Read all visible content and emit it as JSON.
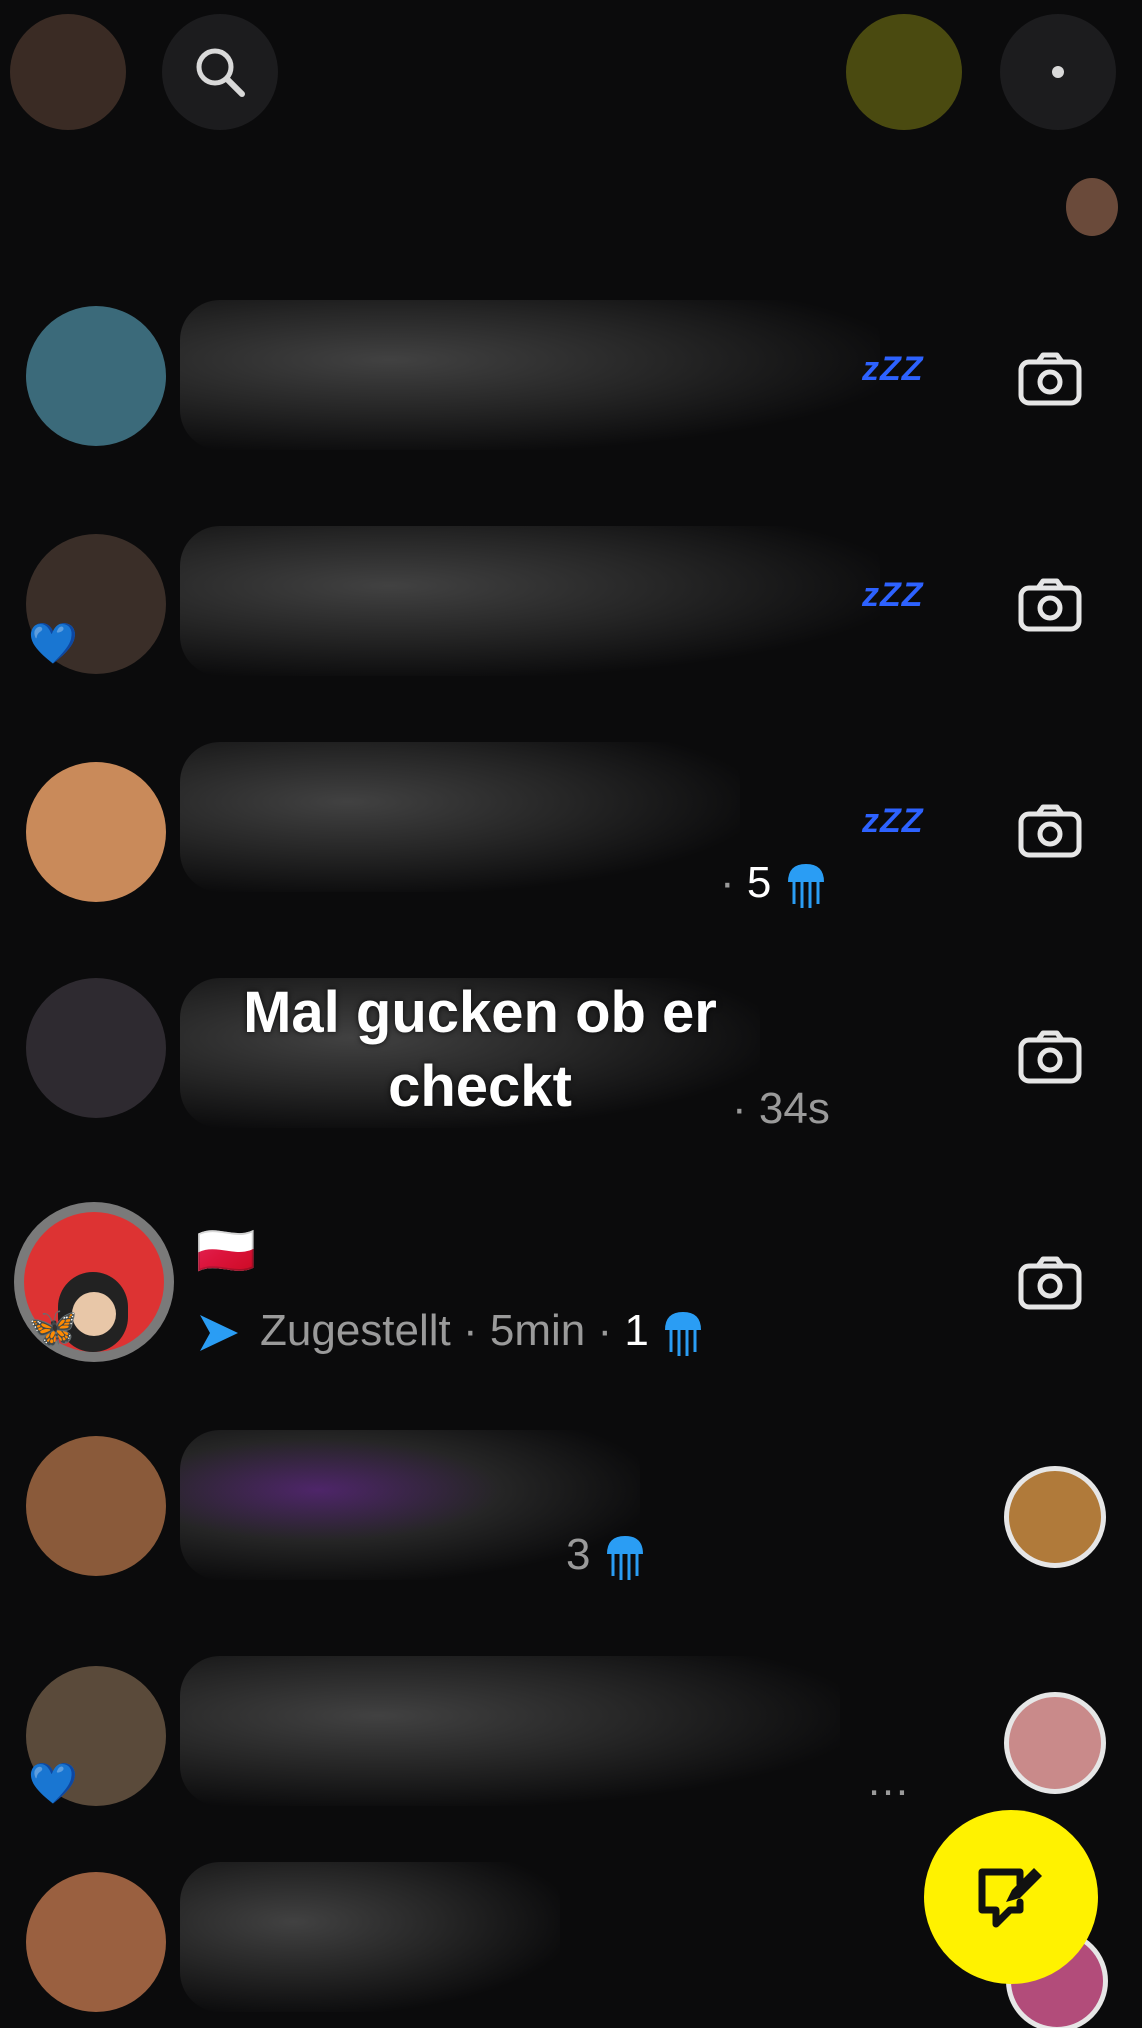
{
  "overlay": {
    "caption": "Mal gucken ob er checkt"
  },
  "topbar": {
    "profile_icon": "profile-avatar-icon",
    "search_icon": "search-icon",
    "story_icon": "story-avatar-icon",
    "more_icon": "more-icon"
  },
  "colors": {
    "background": "#0b0b0c",
    "accent_yellow": "#fff200",
    "delivered_blue": "#2a9df4",
    "zzz_blue": "#2d62ff"
  },
  "chats": [
    {
      "name": "",
      "status": "",
      "zzz": "zZZ",
      "action_icon": "camera-icon"
    },
    {
      "name": "",
      "status": "",
      "badge": "💙",
      "zzz": "zZZ",
      "action_icon": "camera-icon"
    },
    {
      "name": "",
      "status_count": "5",
      "zzz": "zZZ",
      "action_icon": "camera-icon"
    },
    {
      "name": "",
      "status_time": "34s",
      "action_icon": "camera-icon"
    },
    {
      "name": "🇵🇱",
      "status": "Zugestellt",
      "status_sep1": "·",
      "status_time": "5min",
      "status_sep2": "·",
      "status_count": "1",
      "badge": "🦋",
      "action_icon": "camera-icon"
    },
    {
      "name": "",
      "status_count": "3",
      "action_icon": "story-thumbnail"
    },
    {
      "name": "",
      "status": "…",
      "badge": "💙",
      "action_icon": "story-thumbnail"
    },
    {
      "name": "",
      "status": "",
      "action_icon": "story-thumbnail"
    }
  ],
  "fab": {
    "icon": "compose-chat-icon"
  }
}
